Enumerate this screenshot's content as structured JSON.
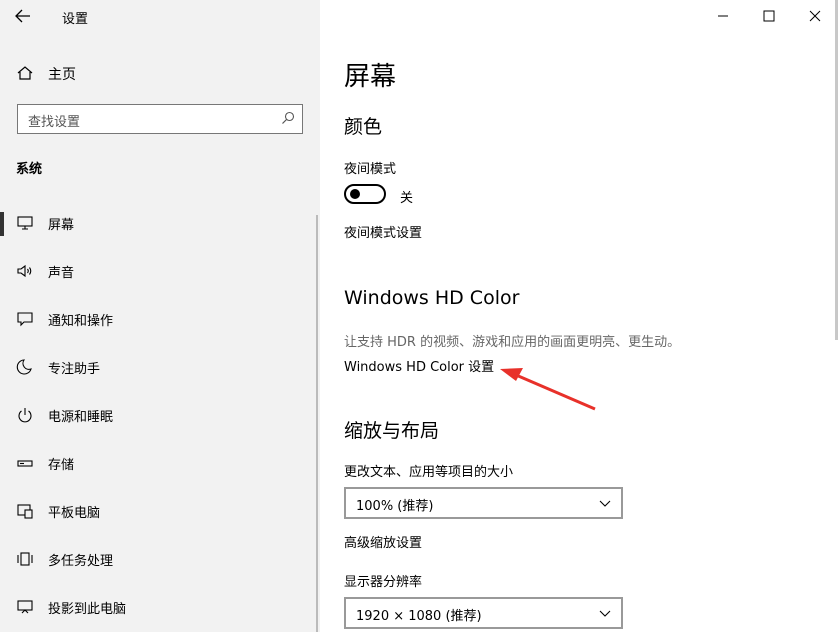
{
  "window": {
    "title": "设置"
  },
  "sidebar": {
    "home_label": "主页",
    "search_placeholder": "查找设置",
    "section_label": "系统",
    "items": [
      {
        "label": "屏幕",
        "icon": "monitor-icon",
        "active": true
      },
      {
        "label": "声音",
        "icon": "speaker-icon"
      },
      {
        "label": "通知和操作",
        "icon": "message-icon"
      },
      {
        "label": "专注助手",
        "icon": "moon-icon"
      },
      {
        "label": "电源和睡眠",
        "icon": "power-icon"
      },
      {
        "label": "存储",
        "icon": "storage-icon"
      },
      {
        "label": "平板电脑",
        "icon": "tablet-icon"
      },
      {
        "label": "多任务处理",
        "icon": "multitask-icon"
      },
      {
        "label": "投影到此电脑",
        "icon": "projector-icon"
      }
    ]
  },
  "main": {
    "title": "屏幕",
    "color_heading": "颜色",
    "night_mode_label": "夜间模式",
    "night_mode_state": "关",
    "night_mode_settings_link": "夜间模式设置",
    "hdr_heading": "Windows HD Color",
    "hdr_description": "让支持 HDR 的视频、游戏和应用的画面更明亮、更生动。",
    "hdr_settings_link": "Windows HD Color 设置",
    "scale_heading": "缩放与布局",
    "scale_label": "更改文本、应用等项目的大小",
    "scale_value": "100% (推荐)",
    "advanced_scaling_link": "高级缩放设置",
    "resolution_label": "显示器分辨率",
    "resolution_value": "1920 × 1080 (推荐)"
  },
  "colors": {
    "sidebar_bg": "#f2f2f2",
    "annotation_arrow": "#e8312a"
  }
}
